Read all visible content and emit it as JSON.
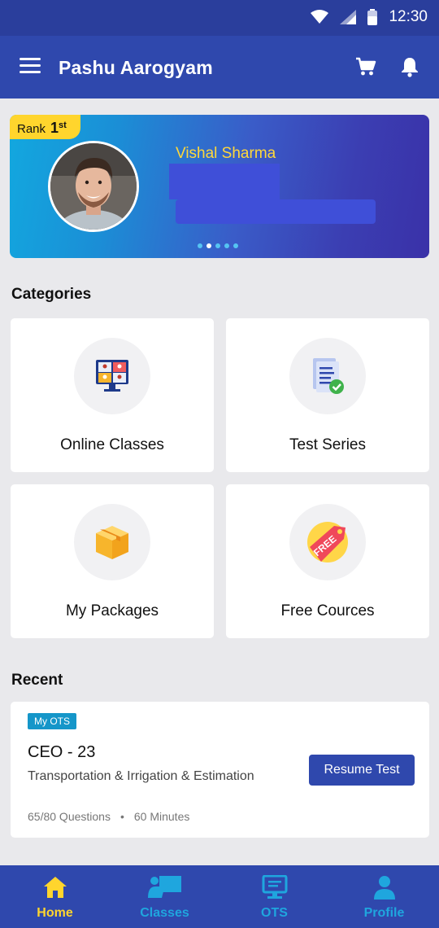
{
  "status": {
    "time": "12:30"
  },
  "appbar": {
    "title": "Pashu Aarogyam"
  },
  "banner": {
    "rank_label": "Rank",
    "rank_number": "1",
    "rank_suffix": "st",
    "name": "Vishal Sharma",
    "slides": 5,
    "active_slide": 1
  },
  "categories": {
    "title": "Categories",
    "items": [
      {
        "label": "Online Classes",
        "icon": "video-conference-icon"
      },
      {
        "label": "Test Series",
        "icon": "document-check-icon"
      },
      {
        "label": "My Packages",
        "icon": "package-box-icon"
      },
      {
        "label": "Free Cources",
        "icon": "free-tag-icon"
      }
    ]
  },
  "recent": {
    "title": "Recent",
    "item": {
      "tag": "My OTS",
      "title": "CEO - 23",
      "subtitle": "Transportation & Irrigation & Estimation",
      "questions": "65/80 Questions",
      "separator": "•",
      "duration": "60 Minutes",
      "action": "Resume Test"
    }
  },
  "bottom_nav": {
    "items": [
      {
        "label": "Home",
        "icon": "home-icon",
        "active": true
      },
      {
        "label": "Classes",
        "icon": "classes-icon",
        "active": false
      },
      {
        "label": "OTS",
        "icon": "ots-monitor-icon",
        "active": false
      },
      {
        "label": "Profile",
        "icon": "profile-icon",
        "active": false
      }
    ]
  },
  "colors": {
    "primary": "#2f48ad",
    "statusbar": "#2a3e9c",
    "accent_yellow": "#ffd52d",
    "accent_blue": "#1fa6de",
    "background": "#e9e9ec"
  }
}
